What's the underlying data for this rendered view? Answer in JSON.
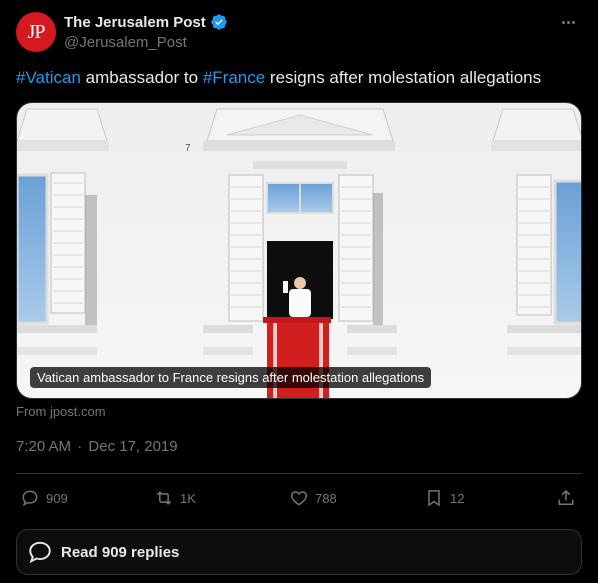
{
  "author": {
    "avatar_text": "JP",
    "display_name": "The Jerusalem Post",
    "handle": "@Jerusalem_Post",
    "verified": true
  },
  "tweet": {
    "hashtag1": "#Vatican",
    "text1": " ambassador to ",
    "hashtag2": "#France",
    "text2": " resigns after molestation allegations"
  },
  "card": {
    "caption": "Vatican ambassador to France resigns after molestation allegations",
    "source": "From jpost.com"
  },
  "meta": {
    "time": "7:20 AM",
    "separator": "·",
    "date": "Dec 17, 2019"
  },
  "actions": {
    "replies": "909",
    "retweets": "1K",
    "likes": "788",
    "bookmarks": "12"
  },
  "read_replies_label": "Read 909 replies",
  "colors": {
    "accent": "#1d9bf0",
    "background": "#000000",
    "muted": "#71767b",
    "brand_red": "#d41a1f"
  }
}
